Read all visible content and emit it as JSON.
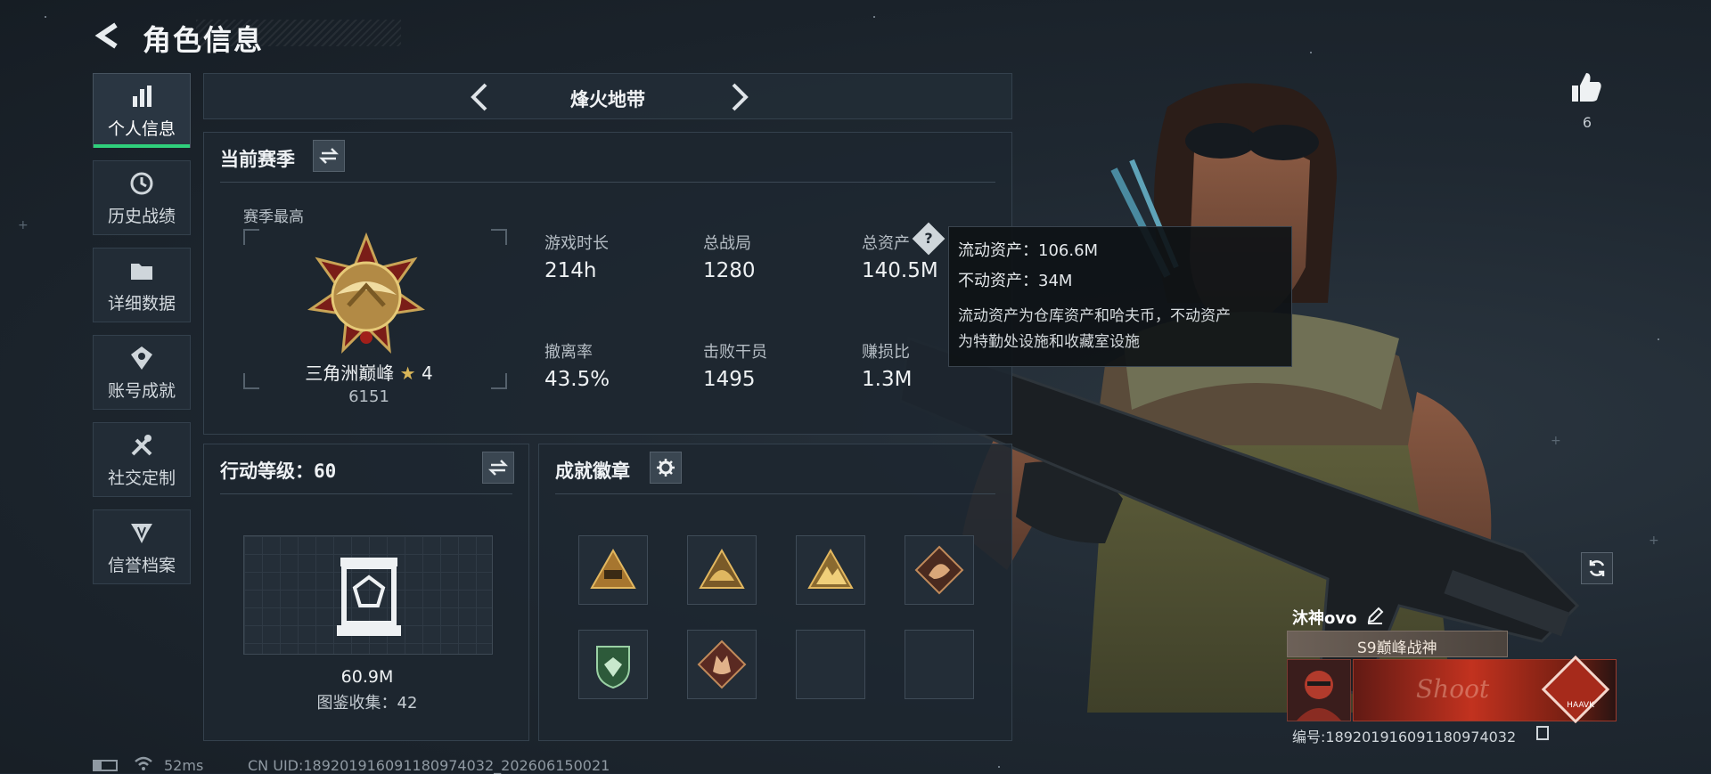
{
  "header": {
    "title": "角色信息"
  },
  "sidebar": {
    "items": [
      {
        "label": "个人信息",
        "active": true,
        "icon": "bar-chart-icon"
      },
      {
        "label": "历史战绩",
        "icon": "history-clock-icon"
      },
      {
        "label": "详细数据",
        "icon": "folder-icon"
      },
      {
        "label": "账号成就",
        "icon": "achievement-icon"
      },
      {
        "label": "社交定制",
        "icon": "tools-icon"
      },
      {
        "label": "信誉档案",
        "icon": "shield-icon"
      }
    ]
  },
  "mode": {
    "name": "烽火地带"
  },
  "season": {
    "title": "当前赛季",
    "best_label": "赛季最高",
    "rank_name": "三角洲巅峰",
    "rank_stars": "4",
    "rank_score": "6151",
    "stats": [
      {
        "label": "游戏时长",
        "value": "214h"
      },
      {
        "label": "总战局",
        "value": "1280"
      },
      {
        "label": "总资产",
        "value": "140.5M",
        "has_help": true
      },
      {
        "label": "撤离率",
        "value": "43.5%"
      },
      {
        "label": "击败干员",
        "value": "1495"
      },
      {
        "label": "赚损比",
        "value": "1.3M"
      }
    ]
  },
  "tooltip": {
    "liquid": "流动资产：106.6M",
    "fixed": "不动资产：34M",
    "desc_line1": "流动资产为仓库资产和哈夫币，不动资产",
    "desc_line2": "为特勤处设施和收藏室设施"
  },
  "action_level": {
    "title": "行动等级：60",
    "value": "60.9M",
    "collection": "图鉴收集：42"
  },
  "achievements": {
    "title": "成就徽章",
    "badges": [
      {
        "icon": "pyramid-badge-icon",
        "filled": true
      },
      {
        "icon": "helmet-badge-icon",
        "filled": true
      },
      {
        "icon": "mountain-badge-icon",
        "filled": true
      },
      {
        "icon": "dragon-badge-icon",
        "filled": true
      },
      {
        "icon": "green-shield-badge-icon",
        "filled": true
      },
      {
        "icon": "wolf-badge-icon",
        "filled": true
      },
      {
        "icon": "empty-slot",
        "filled": false
      },
      {
        "icon": "empty-slot",
        "filled": false
      }
    ]
  },
  "likes": {
    "count": "6"
  },
  "player": {
    "name": "沐神ovo",
    "title": "S9巅峰战神",
    "banner_text": "Shoot",
    "banner_logo": "HAAVK",
    "id_text": "编号:1892019160911809740​32"
  },
  "status_bar": {
    "ping": "52ms",
    "uid": "CN UID:18920191609​11809740​32_202606150021"
  },
  "colors": {
    "accent_green": "#2fd07c",
    "gold": "#c9a456",
    "banner_red": "#c2321f"
  }
}
